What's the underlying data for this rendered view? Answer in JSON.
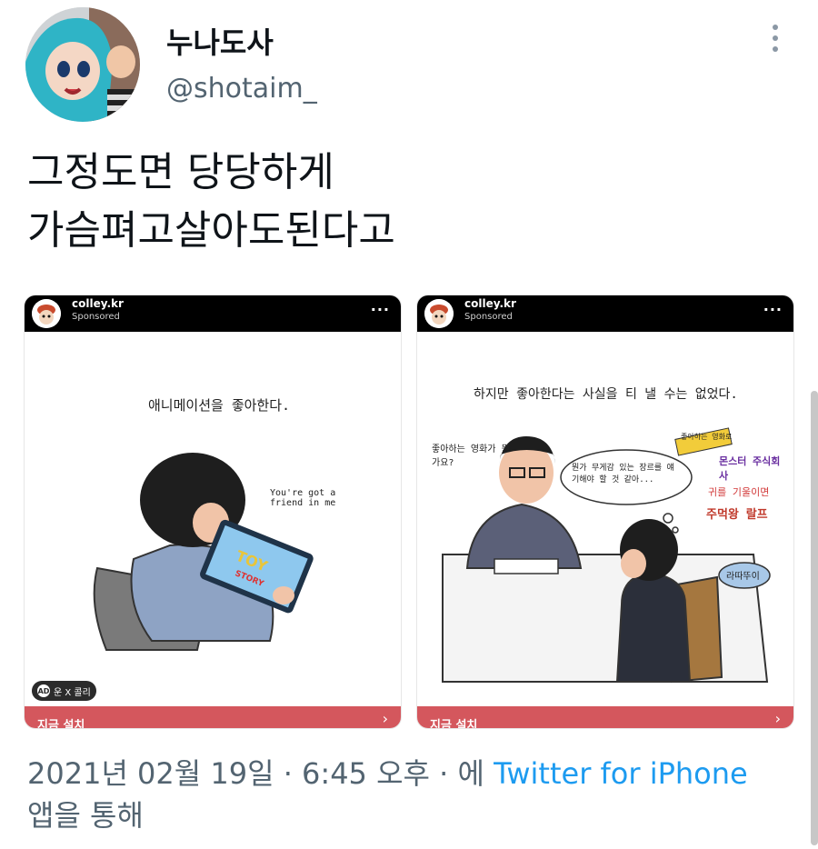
{
  "user": {
    "display_name": "누나도사",
    "handle": "@shotaim_"
  },
  "tweet": {
    "line1": "그정도면 당당하게",
    "line2": "가슴펴고살아도된다고"
  },
  "cards": [
    {
      "account": "colley.kr",
      "sponsored": "Sponsored",
      "caption": "애니메이션을 좋아한다.",
      "song": "You're got a friend in me",
      "brand": "TOY STORY",
      "ad_label": "AD",
      "ad_text": "운 X 콜리",
      "cta": "지금 설치",
      "chevron": "›"
    },
    {
      "account": "colley.kr",
      "sponsored": "Sponsored",
      "caption": "하지만 좋아한다는 사실을 티 낼 수는 없었다.",
      "bubble_left": "좋아하는 영화가 뭔가요?",
      "bubble_mid": "뭔가 무게감 있는 장르를 얘기해야 할 것 같아...",
      "sign1": "좋아하는 영화로",
      "sign2": "몬스터 주식회사",
      "sign3": "귀를 기울이면",
      "sign4": "주먹왕 랄프",
      "sign5": "라따뚜이",
      "cta": "지금 설치",
      "chevron": "›"
    }
  ],
  "meta": {
    "timestamp": "2021년 02월 19일 · 6:45 오후 · 에 ",
    "source": "Twitter for iPhone",
    "suffix": "앱을 통해"
  },
  "colors": {
    "link": "#1d9bf0",
    "cta": "#d4575d",
    "muted": "#536471"
  }
}
